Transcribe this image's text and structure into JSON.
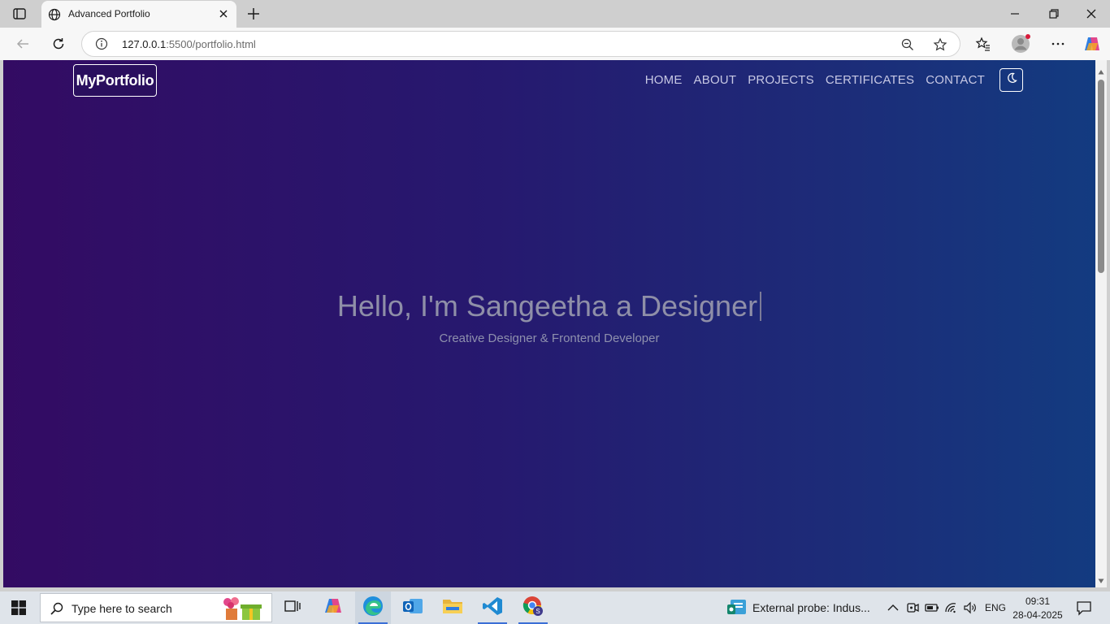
{
  "browser": {
    "tab_title": "Advanced Portfolio",
    "url_host": "127.0.0.1",
    "url_path": ":5500/portfolio.html",
    "icons": {
      "tab_actions": "tab-actions-icon",
      "favicon": "globe-icon",
      "tab_close": "close-icon",
      "new_tab": "plus-icon",
      "back": "back-arrow-icon",
      "refresh": "refresh-icon",
      "info": "info-icon",
      "zoom": "zoom-out-icon",
      "favorite": "star-icon",
      "favorites": "favorites-icon",
      "profile": "profile-icon",
      "menu": "more-icon",
      "copilot": "copilot-icon"
    }
  },
  "page": {
    "logo": "MyPortfolio",
    "nav": [
      "HOME",
      "ABOUT",
      "PROJECTS",
      "CERTIFICATES",
      "CONTACT"
    ],
    "theme_toggle_icon": "moon-icon",
    "hero_title": "Hello, I'm Sangeetha a Designer",
    "hero_subtitle": "Creative Designer & Frontend Developer",
    "colors": {
      "gradient_left": "#330b63",
      "gradient_right": "#133b80",
      "nav_text": "#c7c8e4"
    }
  },
  "taskbar": {
    "search_placeholder": "Type here to search",
    "probe_text": "External probe: Indus...",
    "language": "ENG",
    "time": "09:31",
    "date": "28-04-2025"
  }
}
